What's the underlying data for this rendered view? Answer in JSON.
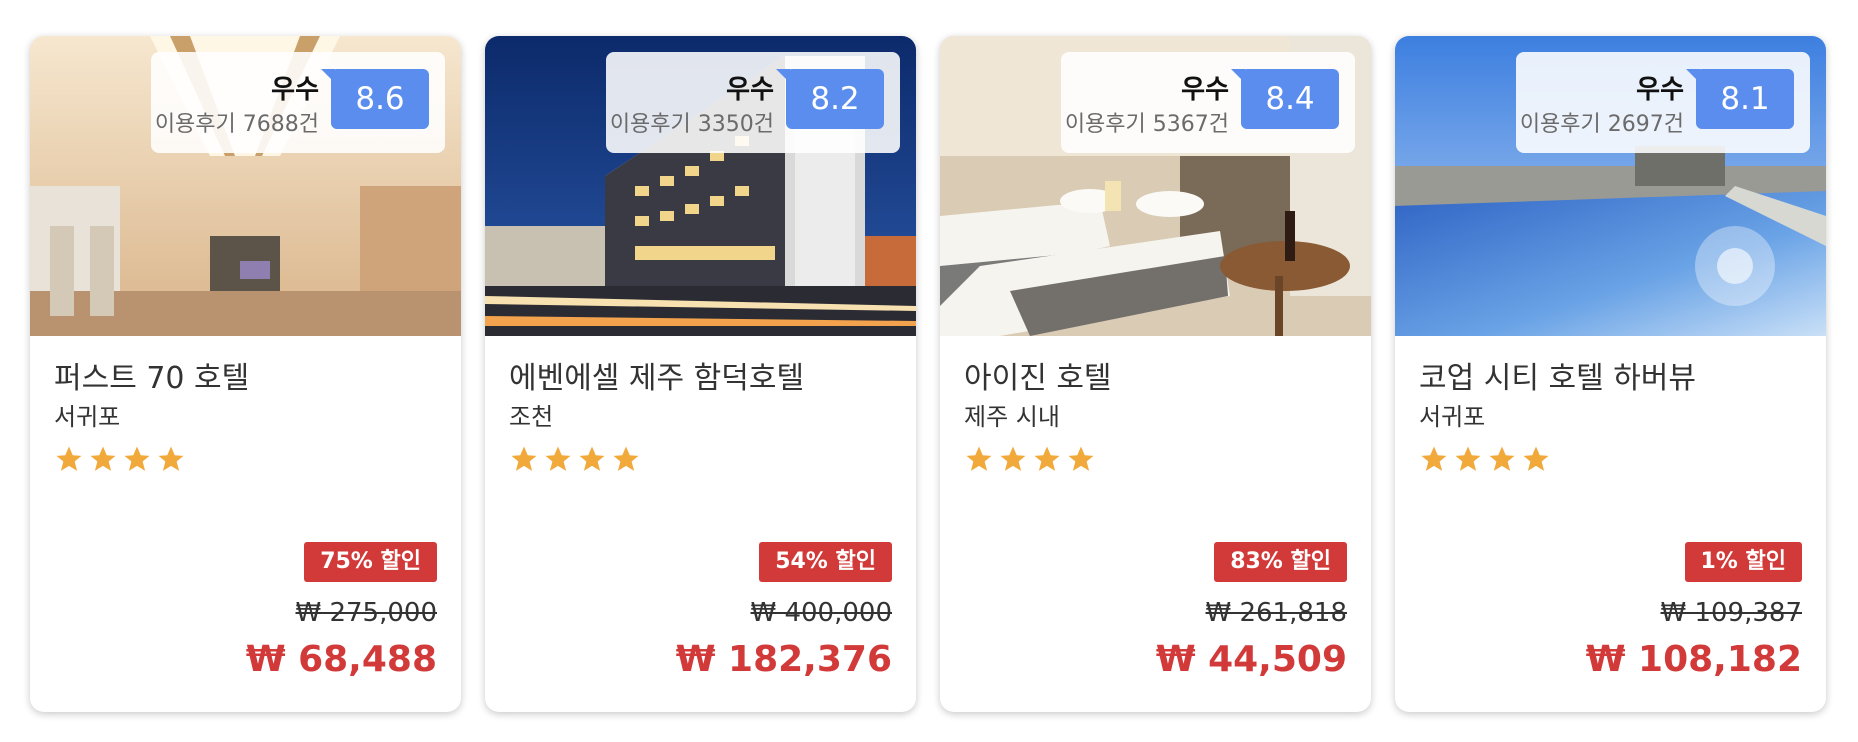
{
  "colors": {
    "accent": "#5b8def",
    "discount": "#d23a3a",
    "star": "#f2a93b"
  },
  "cards": [
    {
      "name": "퍼스트 70 호텔",
      "area": "서귀포",
      "grade": "우수",
      "reviews": "이용후기 7688건",
      "score": "8.6",
      "stars": 4,
      "discount": "75% 할인",
      "original_price": "₩ 275,000",
      "final_price": "₩ 68,488",
      "photo": "hotel-lobby-photo"
    },
    {
      "name": "에벤에셀 제주 함덕호텔",
      "area": "조천",
      "grade": "우수",
      "reviews": "이용후기 3350건",
      "score": "8.2",
      "stars": 4,
      "discount": "54% 할인",
      "original_price": "₩ 400,000",
      "final_price": "₩ 182,376",
      "photo": "hotel-night-exterior-photo"
    },
    {
      "name": "아이진 호텔",
      "area": "제주 시내",
      "grade": "우수",
      "reviews": "이용후기 5367건",
      "score": "8.4",
      "stars": 4,
      "discount": "83% 할인",
      "original_price": "₩ 261,818",
      "final_price": "₩ 44,509",
      "photo": "hotel-twin-room-photo"
    },
    {
      "name": "코업 시티 호텔 하버뷰",
      "area": "서귀포",
      "grade": "우수",
      "reviews": "이용후기 2697건",
      "score": "8.1",
      "stars": 4,
      "discount": "1% 할인",
      "original_price": "₩ 109,387",
      "final_price": "₩ 108,182",
      "photo": "hotel-rooftop-pool-photo"
    }
  ]
}
